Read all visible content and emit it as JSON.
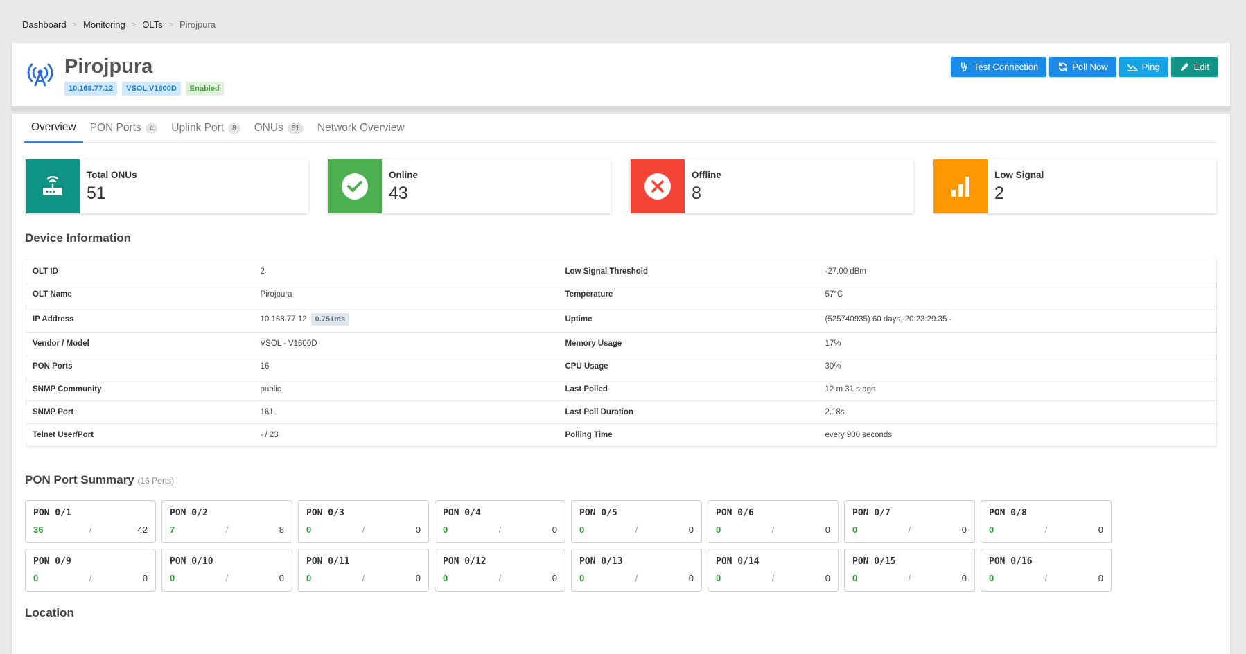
{
  "breadcrumb": [
    "Dashboard",
    "Monitoring",
    "OLTs",
    "Pirojpura"
  ],
  "olt": {
    "name": "Pirojpura",
    "ip_badge": "10.168.77.12",
    "model_badge": "VSOL V1600D",
    "status_badge": "Enabled"
  },
  "actions": {
    "test_connection": "Test Connection",
    "poll_now": "Poll Now",
    "ping": "Ping",
    "edit": "Edit"
  },
  "tabs": [
    {
      "label": "Overview",
      "count": ""
    },
    {
      "label": "PON Ports",
      "count": "4"
    },
    {
      "label": "Uplink Port",
      "count": "8"
    },
    {
      "label": "ONUs",
      "count": "51"
    },
    {
      "label": "Network Overview",
      "count": ""
    }
  ],
  "stats": [
    {
      "label": "Total ONUs",
      "value": "51",
      "color": "#0f9485",
      "icon": "router-icon"
    },
    {
      "label": "Online",
      "value": "43",
      "color": "#4caf50",
      "icon": "check-circle-icon"
    },
    {
      "label": "Offline",
      "value": "8",
      "color": "#f44336",
      "icon": "close-circle-icon"
    },
    {
      "label": "Low Signal",
      "value": "2",
      "color": "#ff9800",
      "icon": "signal-bars-icon"
    }
  ],
  "device_info": {
    "title": "Device Information",
    "rows": [
      {
        "k1": "OLT ID",
        "v1": "2",
        "k2": "Low Signal Threshold",
        "v2": "-27.00 dBm"
      },
      {
        "k1": "OLT Name",
        "v1": "Pirojpura",
        "k2": "Temperature",
        "v2": "57°C"
      },
      {
        "k1": "IP Address",
        "v1": "10.168.77.12",
        "latency": "0.751ms",
        "k2": "Uptime",
        "v2": "(525740935) 60 days, 20:23:29.35 -"
      },
      {
        "k1": "Vendor / Model",
        "v1": "VSOL - V1600D",
        "k2": "Memory Usage",
        "v2": "17%"
      },
      {
        "k1": "PON Ports",
        "v1": "16",
        "k2": "CPU Usage",
        "v2": "30%"
      },
      {
        "k1": "SNMP Community",
        "v1": "public",
        "k2": "Last Polled",
        "v2": "12 m 31 s ago"
      },
      {
        "k1": "SNMP Port",
        "v1": "161",
        "k2": "Last Poll Duration",
        "v2": "2.18s"
      },
      {
        "k1": "Telnet User/Port",
        "v1": "- / 23",
        "k2": "Polling Time",
        "v2": "every 900 seconds"
      }
    ]
  },
  "pon_summary": {
    "title": "PON Port Summary",
    "subtitle": "(16 Ports)",
    "ports": [
      {
        "name": "PON 0/1",
        "online": "36",
        "total": "42"
      },
      {
        "name": "PON 0/2",
        "online": "7",
        "total": "8"
      },
      {
        "name": "PON 0/3",
        "online": "0",
        "total": "0"
      },
      {
        "name": "PON 0/4",
        "online": "0",
        "total": "0"
      },
      {
        "name": "PON 0/5",
        "online": "0",
        "total": "0"
      },
      {
        "name": "PON 0/6",
        "online": "0",
        "total": "0"
      },
      {
        "name": "PON 0/7",
        "online": "0",
        "total": "0"
      },
      {
        "name": "PON 0/8",
        "online": "0",
        "total": "0"
      },
      {
        "name": "PON 0/9",
        "online": "0",
        "total": "0"
      },
      {
        "name": "PON 0/10",
        "online": "0",
        "total": "0"
      },
      {
        "name": "PON 0/11",
        "online": "0",
        "total": "0"
      },
      {
        "name": "PON 0/12",
        "online": "0",
        "total": "0"
      },
      {
        "name": "PON 0/13",
        "online": "0",
        "total": "0"
      },
      {
        "name": "PON 0/14",
        "online": "0",
        "total": "0"
      },
      {
        "name": "PON 0/15",
        "online": "0",
        "total": "0"
      },
      {
        "name": "PON 0/16",
        "online": "0",
        "total": "0"
      }
    ],
    "separator": "/"
  },
  "location": {
    "title": "Location"
  }
}
